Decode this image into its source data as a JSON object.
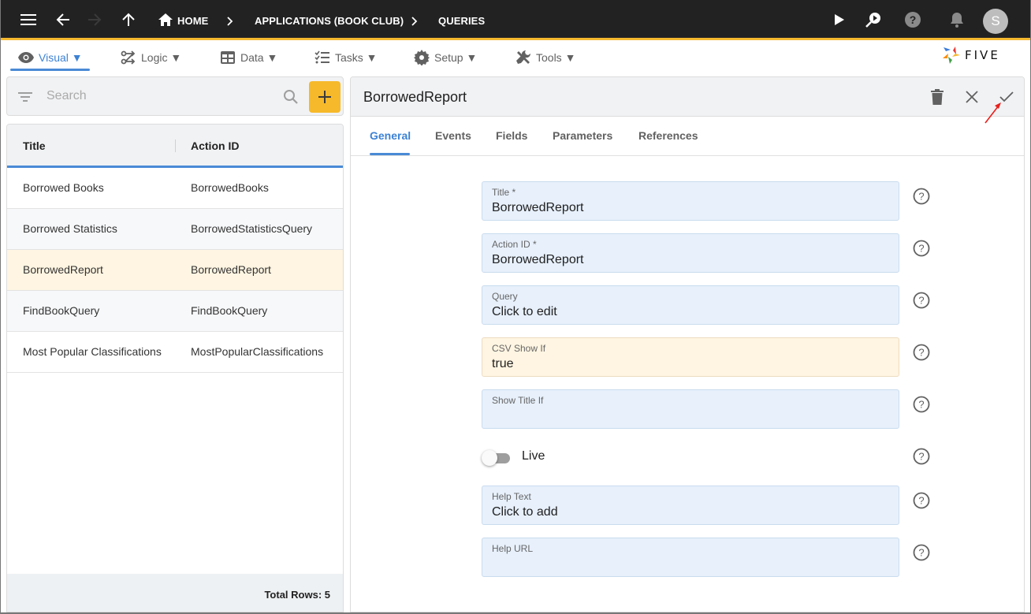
{
  "topbar": {
    "breadcrumbs": [
      "HOME",
      "APPLICATIONS (BOOK CLUB)",
      "QUERIES"
    ],
    "avatar_initial": "S",
    "accent_color": "#f5b82e"
  },
  "menubar": {
    "items": [
      {
        "label": "Visual ▼",
        "icon": "eye-icon",
        "active": true
      },
      {
        "label": "Logic ▼",
        "icon": "logic-icon",
        "active": false
      },
      {
        "label": "Data ▼",
        "icon": "table-icon",
        "active": false
      },
      {
        "label": "Tasks ▼",
        "icon": "checklist-icon",
        "active": false
      },
      {
        "label": "Setup ▼",
        "icon": "gear-icon",
        "active": false
      },
      {
        "label": "Tools ▼",
        "icon": "tools-icon",
        "active": false
      }
    ],
    "logo_text": "FIVE"
  },
  "search": {
    "placeholder": "Search",
    "value": ""
  },
  "list": {
    "columns": [
      "Title",
      "Action ID"
    ],
    "rows": [
      {
        "title": "Borrowed Books",
        "action_id": "BorrowedBooks"
      },
      {
        "title": "Borrowed Statistics",
        "action_id": "BorrowedStatisticsQuery"
      },
      {
        "title": "BorrowedReport",
        "action_id": "BorrowedReport"
      },
      {
        "title": "FindBookQuery",
        "action_id": "FindBookQuery"
      },
      {
        "title": "Most Popular Classifications",
        "action_id": "MostPopularClassifications"
      }
    ],
    "selected_index": 2,
    "total_rows": "Total Rows: 5"
  },
  "form": {
    "title": "BorrowedReport",
    "tabs": [
      "General",
      "Events",
      "Fields",
      "Parameters",
      "References"
    ],
    "active_tab": "General",
    "fields": [
      {
        "label": "Title *",
        "value": "BorrowedReport"
      },
      {
        "label": "Action ID *",
        "value": "BorrowedReport"
      },
      {
        "label": "Query",
        "value": "Click to edit"
      },
      {
        "label": "CSV Show If",
        "value": "true"
      },
      {
        "label": "Show Title If",
        "value": ""
      },
      {
        "label": "Help Text",
        "value": "Click to add"
      },
      {
        "label": "Help URL",
        "value": ""
      }
    ],
    "live_toggle": {
      "label": "Live",
      "on": false
    }
  },
  "colors": {
    "primary": "#4a8ad6",
    "add_button": "#f6b92b",
    "selected_row": "#fff5e2",
    "field_bg": "#e7f0fb",
    "annotation_arrow": "#e8201c"
  }
}
